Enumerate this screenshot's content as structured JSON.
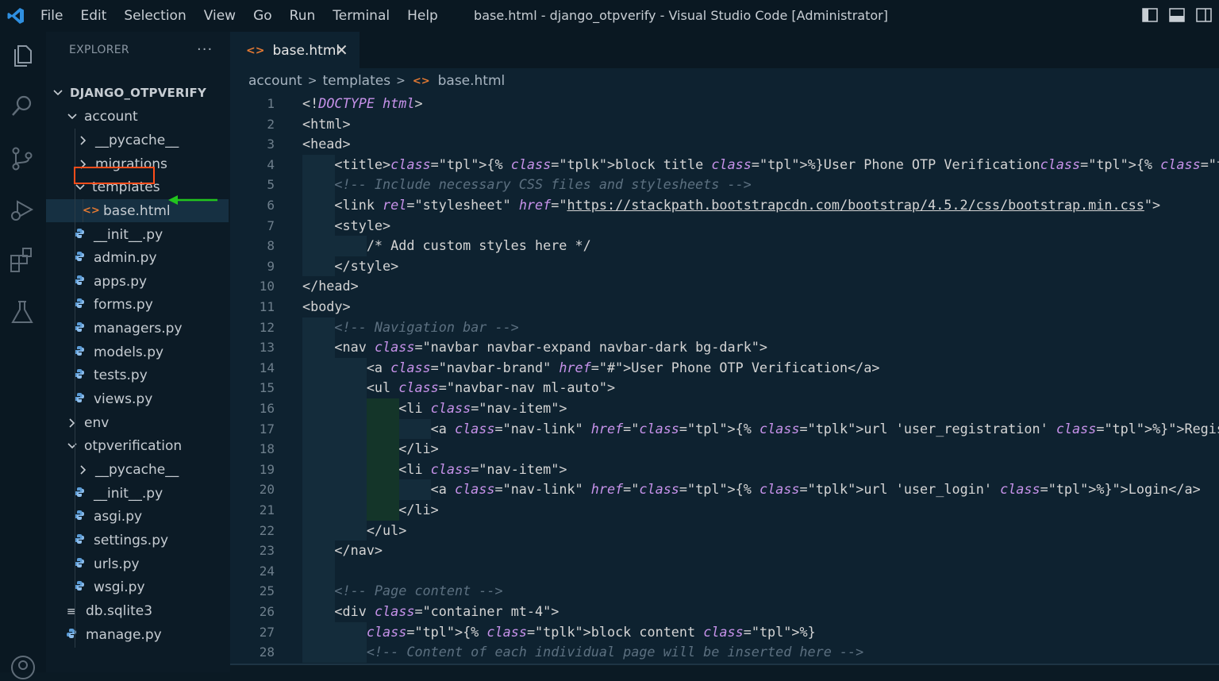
{
  "titlebar": {
    "menu": [
      "File",
      "Edit",
      "Selection",
      "View",
      "Go",
      "Run",
      "Terminal",
      "Help"
    ],
    "title": "base.html - django_otpverify - Visual Studio Code [Administrator]"
  },
  "activity_bar": {
    "icons": [
      "files-icon",
      "search-icon",
      "source-control-icon",
      "run-debug-icon",
      "extensions-icon",
      "testing-icon",
      "account-icon"
    ]
  },
  "sidebar": {
    "header": "EXPLORER",
    "more": "···",
    "tree": [
      {
        "label": "DJANGO_OTPVERIFY",
        "kind": "root-folder",
        "expanded": true
      },
      {
        "label": "account",
        "kind": "folder",
        "expanded": true
      },
      {
        "label": "__pycache__",
        "kind": "folder",
        "expanded": false
      },
      {
        "label": "migrations",
        "kind": "folder",
        "expanded": false
      },
      {
        "label": "templates",
        "kind": "folder",
        "expanded": true
      },
      {
        "label": "base.html",
        "kind": "html"
      },
      {
        "label": "__init__.py",
        "kind": "py"
      },
      {
        "label": "admin.py",
        "kind": "py"
      },
      {
        "label": "apps.py",
        "kind": "py"
      },
      {
        "label": "forms.py",
        "kind": "py"
      },
      {
        "label": "managers.py",
        "kind": "py"
      },
      {
        "label": "models.py",
        "kind": "py"
      },
      {
        "label": "tests.py",
        "kind": "py"
      },
      {
        "label": "views.py",
        "kind": "py"
      },
      {
        "label": "env",
        "kind": "folder",
        "expanded": false
      },
      {
        "label": "otpverification",
        "kind": "folder",
        "expanded": true
      },
      {
        "label": "__pycache__",
        "kind": "folder",
        "expanded": false
      },
      {
        "label": "__init__.py",
        "kind": "py"
      },
      {
        "label": "asgi.py",
        "kind": "py"
      },
      {
        "label": "settings.py",
        "kind": "py"
      },
      {
        "label": "urls.py",
        "kind": "py"
      },
      {
        "label": "wsgi.py",
        "kind": "py"
      },
      {
        "label": "db.sqlite3",
        "kind": "db"
      },
      {
        "label": "manage.py",
        "kind": "py"
      }
    ]
  },
  "editor": {
    "tab": {
      "label": "base.html",
      "close": "✕"
    },
    "breadcrumb": [
      "account",
      "templates",
      "base.html"
    ],
    "line_numbers": [
      "1",
      "2",
      "3",
      "4",
      "5",
      "6",
      "7",
      "8",
      "9",
      "10",
      "11",
      "12",
      "13",
      "14",
      "15",
      "16",
      "17",
      "18",
      "19",
      "20",
      "21",
      "22",
      "23",
      "24",
      "25",
      "26",
      "27",
      "28"
    ],
    "lines": [
      "<!DOCTYPE html>",
      "<html>",
      "<head>",
      "    <title>{% block title %}User Phone OTP Verification{% endblock %}</title>",
      "    <!-- Include necessary CSS files and stylesheets -->",
      "    <link rel=\"stylesheet\" href=\"https://stackpath.bootstrapcdn.com/bootstrap/4.5.2/css/bootstrap.min.css\">",
      "    <style>",
      "        /* Add custom styles here */",
      "    </style>",
      "</head>",
      "<body>",
      "    <!-- Navigation bar -->",
      "    <nav class=\"navbar navbar-expand navbar-dark bg-dark\">",
      "        <a class=\"navbar-brand\" href=\"#\">User Phone OTP Verification</a>",
      "        <ul class=\"navbar-nav ml-auto\">",
      "            <li class=\"nav-item\">",
      "                <a class=\"nav-link\" href=\"{% url 'user_registration' %}\">Register</a>",
      "            </li>",
      "            <li class=\"nav-item\">",
      "                <a class=\"nav-link\" href=\"{% url 'user_login' %}\">Login</a>",
      "            </li>",
      "        </ul>",
      "    </nav>",
      "",
      "    <!-- Page content -->",
      "    <div class=\"container mt-4\">",
      "        {% block content %}",
      "        <!-- Content of each individual page will be inserted here -->"
    ]
  },
  "colors": {
    "background": "#0e2230",
    "titlebar": "#0a1822",
    "attr": "#c792ea",
    "template_delim": "#ffd84d",
    "comment": "#5c7080",
    "highlight_box": "#ff4d1a",
    "arrow": "#22c51e",
    "python_icon": "#5b9bd5",
    "html_icon": "#e37933"
  }
}
